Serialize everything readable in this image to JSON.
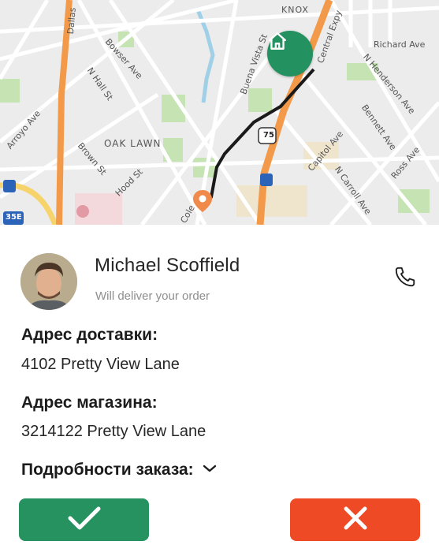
{
  "map": {
    "labels": {
      "knox": "KNOX",
      "oak_lawn": "OAK LAWN",
      "dallas": "Dallas",
      "bowser": "Bowser Ave",
      "n_hall": "N Hall St",
      "arroyo": "Arroyo Ave",
      "brown": "Brown St",
      "hood": "Hood St",
      "buena_vista": "Buena Vista St",
      "central": "Central Expy",
      "henderson": "N Henderson Ave",
      "bennett": "Bennett Ave",
      "capitol": "Capitol Ave",
      "carroll": "N Carroll Ave",
      "ross": "Ross Ave",
      "richard": "Richard Ave",
      "cole": "Cole",
      "highway_75": "75",
      "highway_35e": "35E"
    },
    "colors": {
      "background": "#ececec",
      "highway": "#f39a4a",
      "route": "#1a1a1a",
      "park": "#c6e3b4",
      "water": "#9fd0e8"
    }
  },
  "courier": {
    "name": "Michael Scoffield",
    "subtitle": "Will deliver your order",
    "avatar_icon": "avatar-photo",
    "call_icon": "phone-icon"
  },
  "delivery": {
    "label": "Адрес доставки:",
    "value": "4102 Pretty View Lane"
  },
  "store": {
    "label": "Адрес магазина:",
    "value": "3214122 Pretty View Lane"
  },
  "order_details": {
    "label": "Подробности заказа:",
    "icon": "chevron-down-icon"
  },
  "actions": {
    "accept_icon": "check-icon",
    "decline_icon": "close-icon",
    "accept_color": "#269260",
    "decline_color": "#ee4a25"
  }
}
